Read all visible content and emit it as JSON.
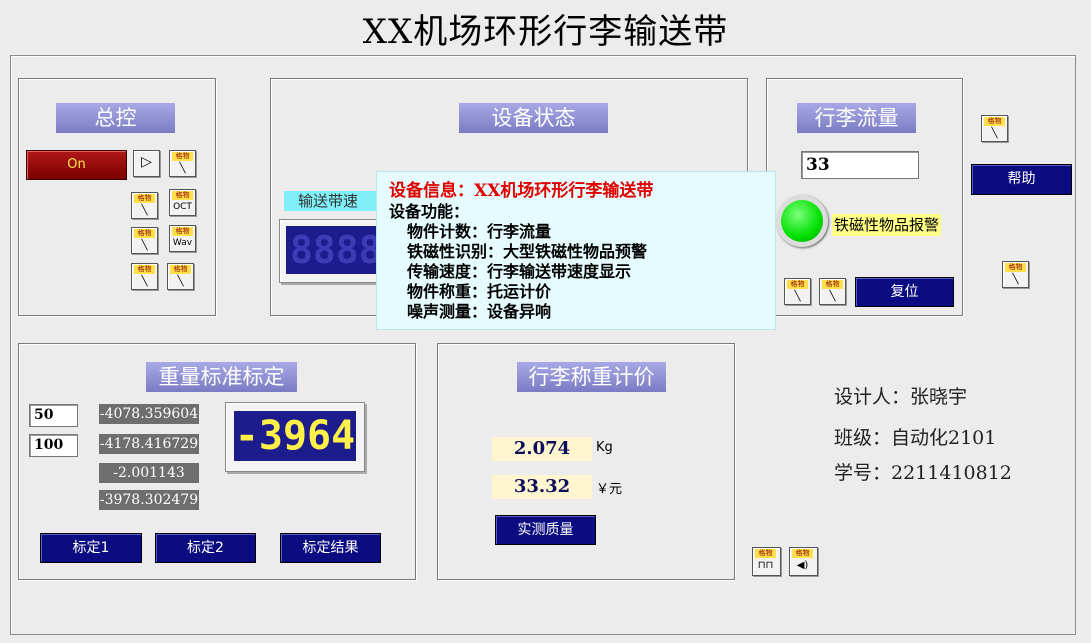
{
  "title": "XX机场环形行李输送带",
  "master": {
    "title": "总控",
    "on_label": "On",
    "icons": [
      "run-arrow-icon",
      "gewu-icon",
      "gewu-icon",
      "gewu-oct-icon",
      "gewu-icon",
      "gewu-wav-icon",
      "gewu-icon",
      "gewu-icon"
    ],
    "icon_top": "格物",
    "oct_label": "OCT",
    "wav_label": "Wav"
  },
  "device_status": {
    "title": "设备状态",
    "speed_label": "输送带速",
    "lcd_value": "8888"
  },
  "flow": {
    "title": "行李流量",
    "count_value": "33",
    "alarm_label": "铁磁性物品报警",
    "alarm_color": "#00e000",
    "reset_label": "复位"
  },
  "help_label": "帮助",
  "calibration": {
    "title": "重量标准标定",
    "input1": "50",
    "input2": "100",
    "values": [
      "-4078.359604",
      "-4178.416729",
      "-2.001143",
      "-3978.302479"
    ],
    "lcd_value": "-3964",
    "btn1": "标定1",
    "btn2": "标定2",
    "btn3": "标定结果"
  },
  "pricing": {
    "title": "行李称重计价",
    "weight_value": "2.074",
    "weight_unit": "Kg",
    "price_value": "33.32",
    "price_unit": "￥元",
    "measure_label": "实测质量"
  },
  "designer": {
    "name_line": "设计人：张晓宇",
    "class_line": "班级：自动化2101",
    "id_line": "学号：2211410812"
  },
  "info_popup": {
    "heading": "设备信息：XX机场环形行李输送带",
    "lines": [
      "设备功能：",
      "  物件计数：行李流量",
      "  铁磁性识别：大型铁磁性物品预警",
      "  传输速度：行李输送带速度显示",
      "  物件称重：托运计价",
      "  噪声测量：设备异响"
    ],
    "heading_color": "#e00000"
  }
}
